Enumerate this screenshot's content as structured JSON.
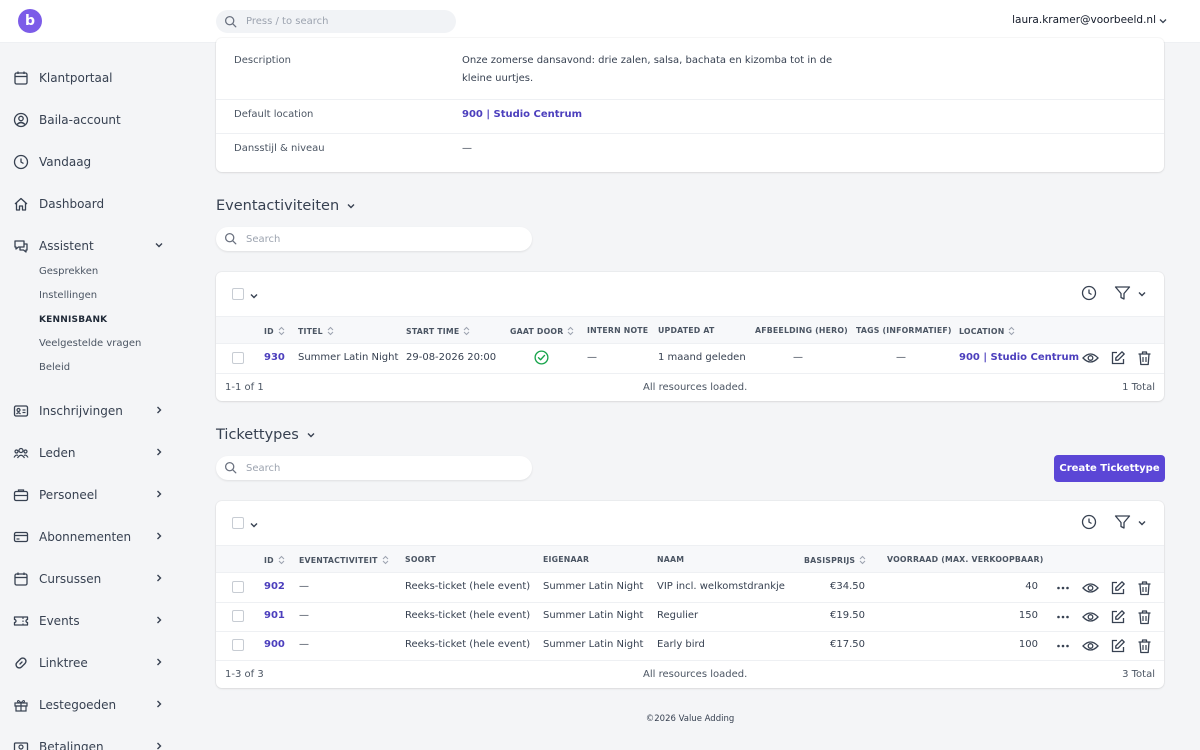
{
  "topbar": {
    "logo_letter": "b",
    "search_placeholder": "Press / to search",
    "user_email": "laura.kramer@voorbeeld.nl"
  },
  "sidebar": {
    "items": [
      {
        "label": "Klantportaal",
        "icon": "calendar-icon"
      },
      {
        "label": "Baila-account",
        "icon": "user-circle-icon"
      },
      {
        "label": "Vandaag",
        "icon": "clock-icon"
      },
      {
        "label": "Dashboard",
        "icon": "home-icon"
      },
      {
        "label": "Assistent",
        "icon": "chat-icon"
      },
      {
        "label": "Inschrijvingen",
        "icon": "id-card-icon"
      },
      {
        "label": "Leden",
        "icon": "users-icon"
      },
      {
        "label": "Personeel",
        "icon": "briefcase-icon"
      },
      {
        "label": "Abonnementen",
        "icon": "credit-card-icon"
      },
      {
        "label": "Cursussen",
        "icon": "calendar-icon"
      },
      {
        "label": "Events",
        "icon": "ticket-icon"
      },
      {
        "label": "Linktree",
        "icon": "link-icon"
      },
      {
        "label": "Lestegoeden",
        "icon": "gift-icon"
      },
      {
        "label": "Betalingen",
        "icon": "money-icon"
      }
    ],
    "assistent_sub": [
      "Gesprekken",
      "Instellingen",
      "KENNISBANK",
      "Veelgestelde vragen",
      "Beleid"
    ]
  },
  "detail": {
    "rows": [
      {
        "label": "Description",
        "value": "Onze zomerse dansavond: drie zalen, salsa, bachata en kizomba tot in de kleine uurtjes."
      },
      {
        "label": "Default location",
        "value": "900 | Studio Centrum"
      },
      {
        "label": "Dansstijl & niveau",
        "value": "—"
      }
    ]
  },
  "activities": {
    "title": "Eventactiviteiten",
    "search_placeholder": "Search",
    "columns": [
      "ID",
      "TITEL",
      "START TIME",
      "GAAT DOOR",
      "INTERN NOTE",
      "UPDATED AT",
      "AFBEELDING (HERO)",
      "TAGS (INFORMATIEF)",
      "LOCATION"
    ],
    "rows": [
      {
        "id": "930",
        "titel": "Summer Latin Night",
        "start": "29-08-2026 20:00",
        "intern": "—",
        "updated": "1 maand geleden",
        "afbeelding": "—",
        "tags": "—",
        "location": "900 | Studio Centrum"
      }
    ],
    "footer": {
      "range": "1-1 of 1",
      "status": "All resources loaded.",
      "total": "1 Total"
    }
  },
  "tickettypes": {
    "title": "Tickettypes",
    "search_placeholder": "Search",
    "create_label": "Create Tickettype",
    "columns": [
      "ID",
      "EVENTACTIVITEIT",
      "SOORT",
      "EIGENAAR",
      "NAAM",
      "BASISPRIJS",
      "VOORRAAD (MAX. VERKOOPBAAR)"
    ],
    "rows": [
      {
        "id": "902",
        "activiteit": "—",
        "soort": "Reeks-ticket (hele event)",
        "eigenaar": "Summer Latin Night",
        "naam": "VIP incl. welkomstdrankje",
        "prijs": "€34.50",
        "voorraad": "40"
      },
      {
        "id": "901",
        "activiteit": "—",
        "soort": "Reeks-ticket (hele event)",
        "eigenaar": "Summer Latin Night",
        "naam": "Regulier",
        "prijs": "€19.50",
        "voorraad": "150"
      },
      {
        "id": "900",
        "activiteit": "—",
        "soort": "Reeks-ticket (hele event)",
        "eigenaar": "Summer Latin Night",
        "naam": "Early bird",
        "prijs": "€17.50",
        "voorraad": "100"
      }
    ],
    "footer": {
      "range": "1-3 of 3",
      "status": "All resources loaded.",
      "total": "3 Total"
    }
  },
  "footer": {
    "text": "©2026 Value Adding"
  },
  "colors": {
    "accent": "#5b46d6",
    "link": "#4c3fbd",
    "success": "#16a34a"
  }
}
